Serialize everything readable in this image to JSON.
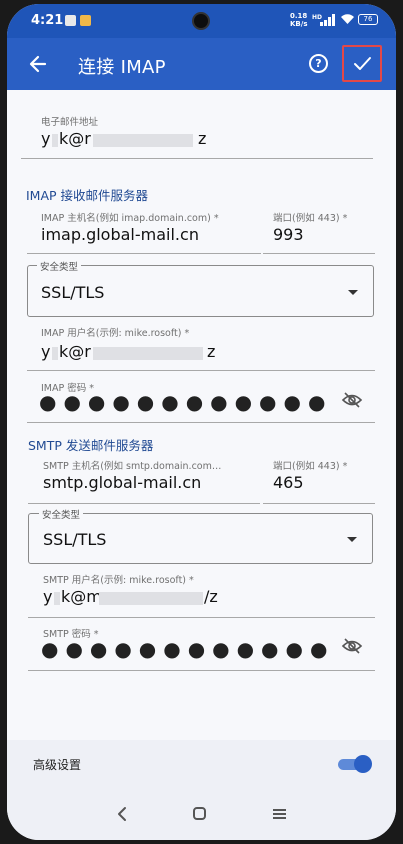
{
  "status": {
    "time": "4:21",
    "net_speed": "0.18",
    "net_unit": "KB/s",
    "hd": "HD",
    "battery": "76"
  },
  "appbar": {
    "title": "连接 IMAP",
    "help": "?"
  },
  "account": {
    "email_label": "电子邮件地址",
    "email_prefix": "y",
    "email_mid": "k@r",
    "email_suffix": "z"
  },
  "imap": {
    "section": "IMAP 接收邮件服务器",
    "host_label": "IMAP 主机名(例如 imap.domain.com) *",
    "host_value": "imap.global-mail.cn",
    "port_label": "端口(例如 443) *",
    "port_value": "993",
    "security_label": "安全类型",
    "security_value": "SSL/TLS",
    "user_label": "IMAP 用户名(示例: mike.rosoft) *",
    "user_prefix": "y",
    "user_mid": "k@r",
    "user_suffix": "z",
    "password_label": "IMAP 密码 *",
    "password_mask": "●●●●●●●●●●●●"
  },
  "smtp": {
    "section": "SMTP 发送邮件服务器",
    "host_label": "SMTP 主机名(例如 smtp.domain.com…",
    "host_value": "smtp.global-mail.cn",
    "port_label": "端口(例如 443) *",
    "port_value": "465",
    "security_label": "安全类型",
    "security_value": "SSL/TLS",
    "user_label": "SMTP 用户名(示例: mike.rosoft) *",
    "user_prefix": "y",
    "user_mid": "k@m",
    "user_suffix": "/z",
    "password_label": "SMTP 密码 *",
    "password_mask": "●●●●●●●●●●●●"
  },
  "advanced": {
    "label": "高级设置",
    "enabled": true
  },
  "colors": {
    "appbar": "#2a5fc4",
    "statusbar": "#1f55b8",
    "section": "#214a93",
    "confirm_highlight": "#e34848"
  },
  "icons": [
    "back-arrow-icon",
    "help-icon",
    "check-icon",
    "eye-off-icon",
    "chevron-down-icon",
    "nav-back-icon",
    "nav-home-icon",
    "nav-menu-icon"
  ]
}
